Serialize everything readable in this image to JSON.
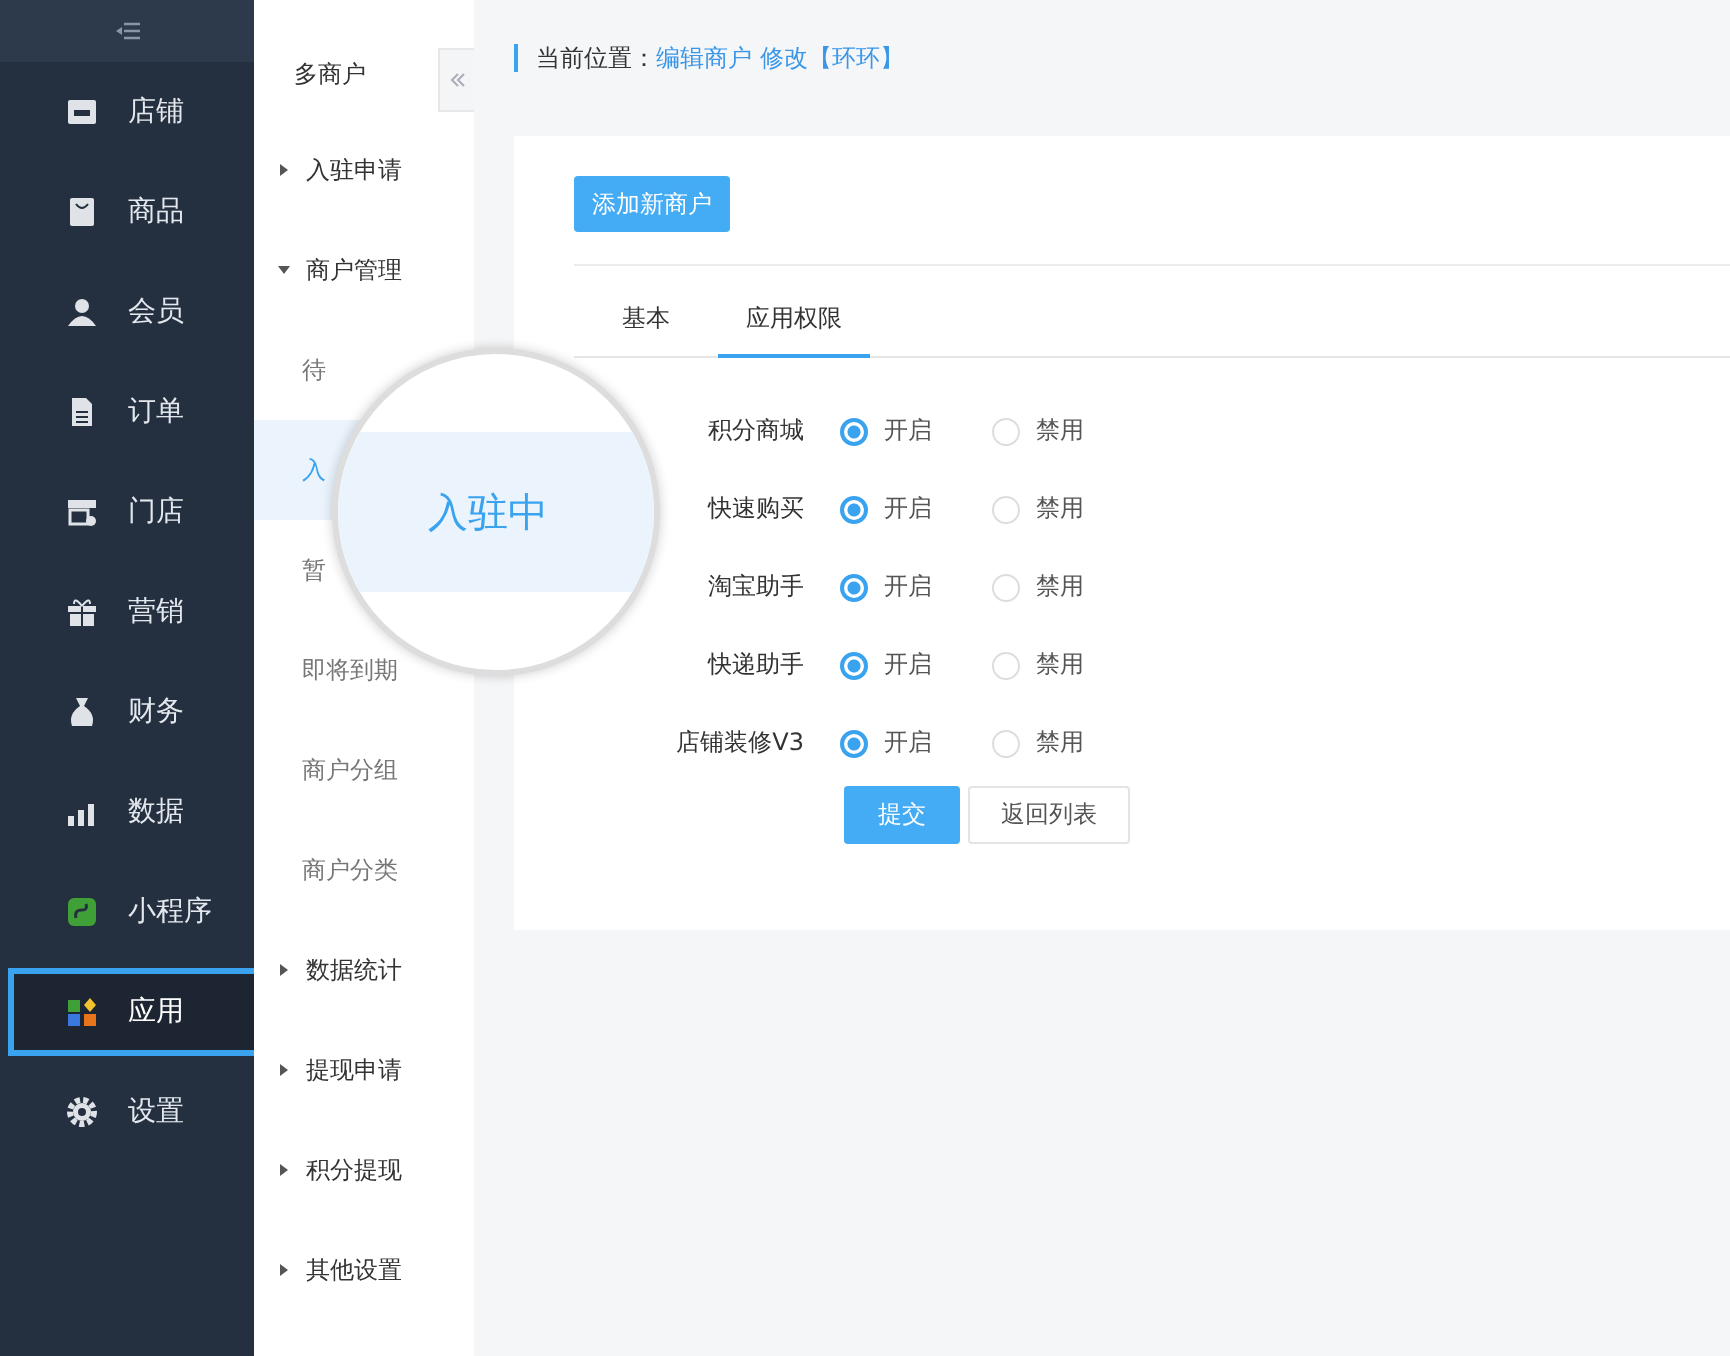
{
  "sidebar": {
    "items": [
      {
        "label": "店铺",
        "selected": false
      },
      {
        "label": "商品",
        "selected": false
      },
      {
        "label": "会员",
        "selected": false
      },
      {
        "label": "订单",
        "selected": false
      },
      {
        "label": "门店",
        "selected": false
      },
      {
        "label": "营销",
        "selected": false
      },
      {
        "label": "财务",
        "selected": false
      },
      {
        "label": "数据",
        "selected": false
      },
      {
        "label": "小程序",
        "selected": false
      },
      {
        "label": "应用",
        "selected": true
      },
      {
        "label": "设置",
        "selected": false
      }
    ]
  },
  "submenu": {
    "title": "多商户",
    "items": [
      {
        "label": "入驻申请",
        "expanded": false
      },
      {
        "label": "商户管理",
        "expanded": true,
        "children": [
          {
            "label": "待",
            "selected": false
          },
          {
            "label": "入",
            "selected": true
          },
          {
            "label": "暂",
            "selected": false
          },
          {
            "label": "即将到期",
            "selected": false
          },
          {
            "label": "商户分组",
            "selected": false
          },
          {
            "label": "商户分类",
            "selected": false
          }
        ]
      },
      {
        "label": "数据统计",
        "expanded": false
      },
      {
        "label": "提现申请",
        "expanded": false
      },
      {
        "label": "积分提现",
        "expanded": false
      },
      {
        "label": "其他设置",
        "expanded": false
      }
    ]
  },
  "magnifier": {
    "text": "入驻中"
  },
  "breadcrumb": {
    "label": "当前位置：",
    "path": "编辑商户 修改【环环】"
  },
  "add_button": "添加新商户",
  "tabs": [
    {
      "label": "基本",
      "selected": false
    },
    {
      "label": "应用权限",
      "selected": true
    }
  ],
  "permissions": [
    {
      "name": "积分商城",
      "enabled": true,
      "on_label": "开启",
      "off_label": "禁用"
    },
    {
      "name": "快速购买",
      "enabled": true,
      "on_label": "开启",
      "off_label": "禁用"
    },
    {
      "name": "淘宝助手",
      "enabled": true,
      "on_label": "开启",
      "off_label": "禁用"
    },
    {
      "name": "快递助手",
      "enabled": true,
      "on_label": "开启",
      "off_label": "禁用"
    },
    {
      "name": "店铺装修V3",
      "enabled": true,
      "on_label": "开启",
      "off_label": "禁用"
    }
  ],
  "buttons": {
    "submit": "提交",
    "back": "返回列表"
  }
}
